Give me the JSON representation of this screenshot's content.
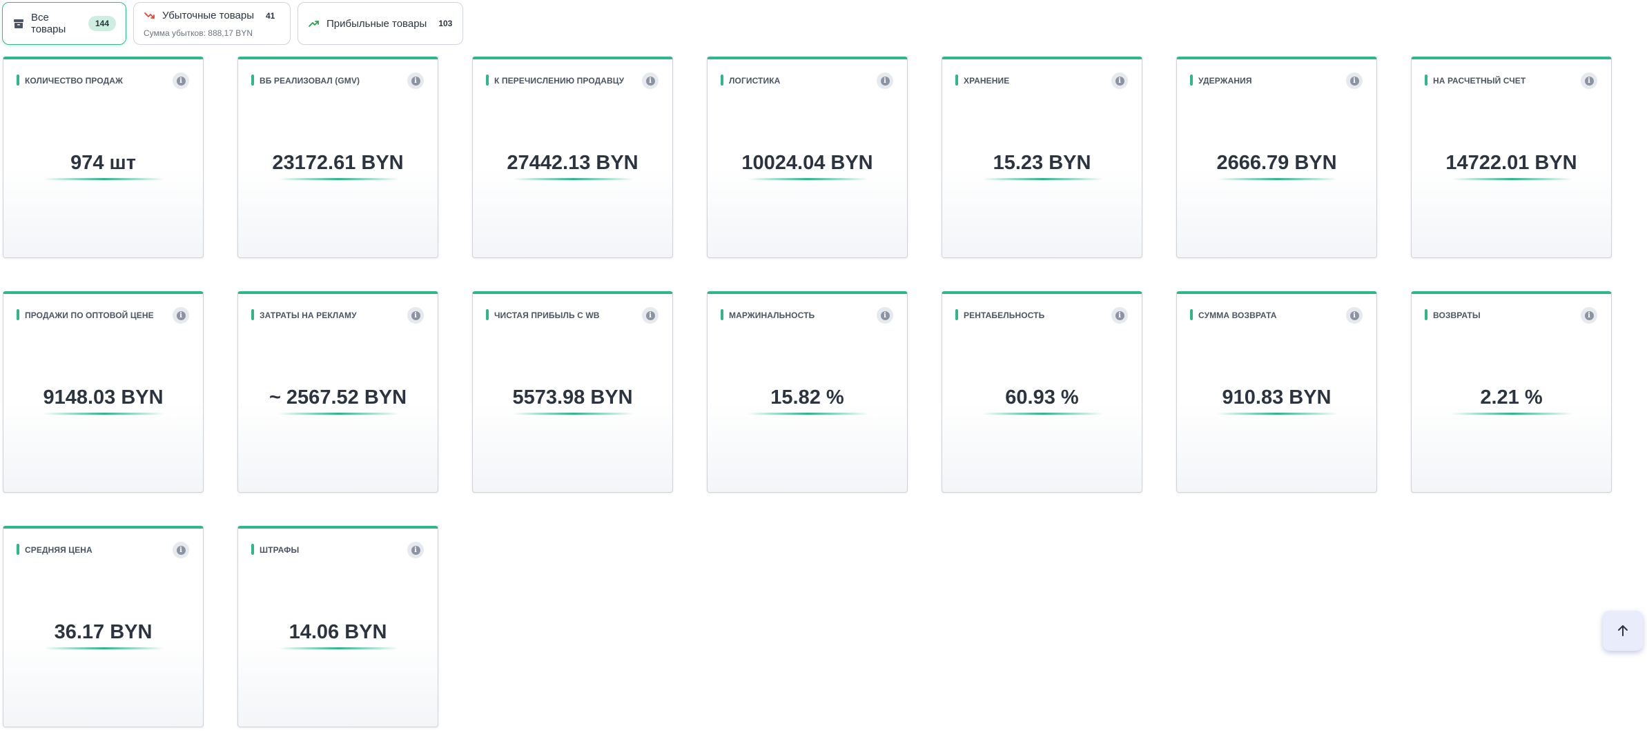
{
  "filters": [
    {
      "label": "Все товары",
      "count": "144",
      "icon": "archive-icon",
      "active": true
    },
    {
      "label": "Убыточные товары",
      "count": "41",
      "sub": "Сумма убытков: 888,17 BYN",
      "icon": "trending-down-icon",
      "icon_color": "#e0453a"
    },
    {
      "label": "Прибыльные товары",
      "count": "103",
      "icon": "trending-up-icon",
      "icon_color": "#2f9e4f"
    }
  ],
  "accent_color": "#2fb68a",
  "cards": [
    {
      "title": "Количество продаж",
      "value": "974 шт"
    },
    {
      "title": "ВБ реализовал (GMV)",
      "value": "23172.61 BYN"
    },
    {
      "title": "К перечислению продавцу",
      "value": "27442.13 BYN"
    },
    {
      "title": "Логистика",
      "value": "10024.04 BYN"
    },
    {
      "title": "Хранение",
      "value": "15.23 BYN"
    },
    {
      "title": "Удержания",
      "value": "2666.79 BYN"
    },
    {
      "title": "На расчетный счет",
      "value": "14722.01 BYN"
    },
    {
      "title": "Продажи по оптовой цене",
      "value": "9148.03 BYN"
    },
    {
      "title": "Затраты на рекламу",
      "value": "~ 2567.52 BYN"
    },
    {
      "title": "Чистая прибыль с WB",
      "value": "5573.98 BYN"
    },
    {
      "title": "Маржинальность",
      "value": "15.82 %"
    },
    {
      "title": "Рентабельность",
      "value": "60.93 %"
    },
    {
      "title": "Сумма возврата",
      "value": "910.83 BYN"
    },
    {
      "title": "Возвраты",
      "value": "2.21 %"
    },
    {
      "title": "Средняя цена",
      "value": "36.17 BYN"
    },
    {
      "title": "Штрафы",
      "value": "14.06 BYN"
    }
  ],
  "info_glyph": "i",
  "scroll_top_icon": "arrow-up-icon"
}
